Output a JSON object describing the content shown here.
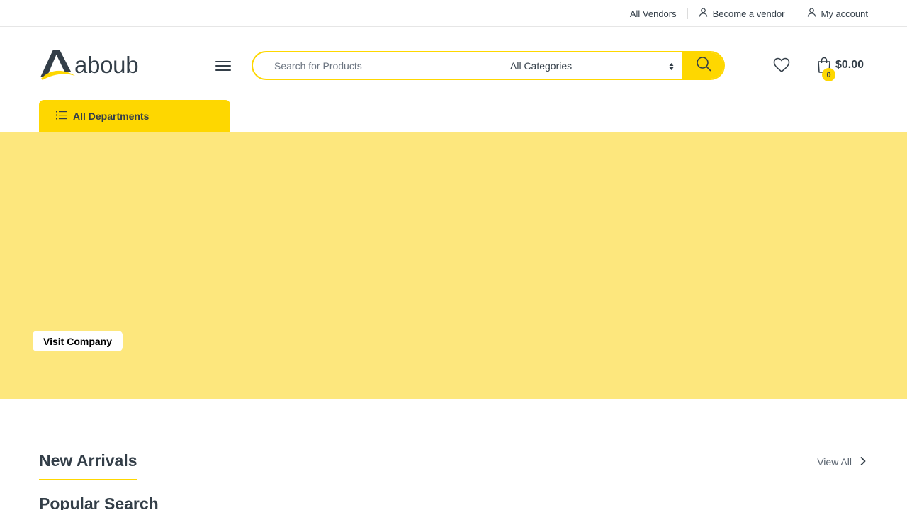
{
  "topbar": {
    "vendors": "All Vendors",
    "become_vendor": "Become a vendor",
    "account": "My account"
  },
  "header": {
    "logo_text": "aboub",
    "search": {
      "placeholder": "Search for Products",
      "category_selected": "All Categories"
    },
    "cart": {
      "count": "0",
      "total": "$0.00"
    },
    "departments_label": "All Departments"
  },
  "hero": {
    "button_label": "Visit Company",
    "background_color": "#fde77d"
  },
  "sections": {
    "new_arrivals": "New Arrivals",
    "view_all": "View All",
    "popular_search": "Popular Search"
  },
  "colors": {
    "accent": "#fed700",
    "text": "#333e48"
  }
}
